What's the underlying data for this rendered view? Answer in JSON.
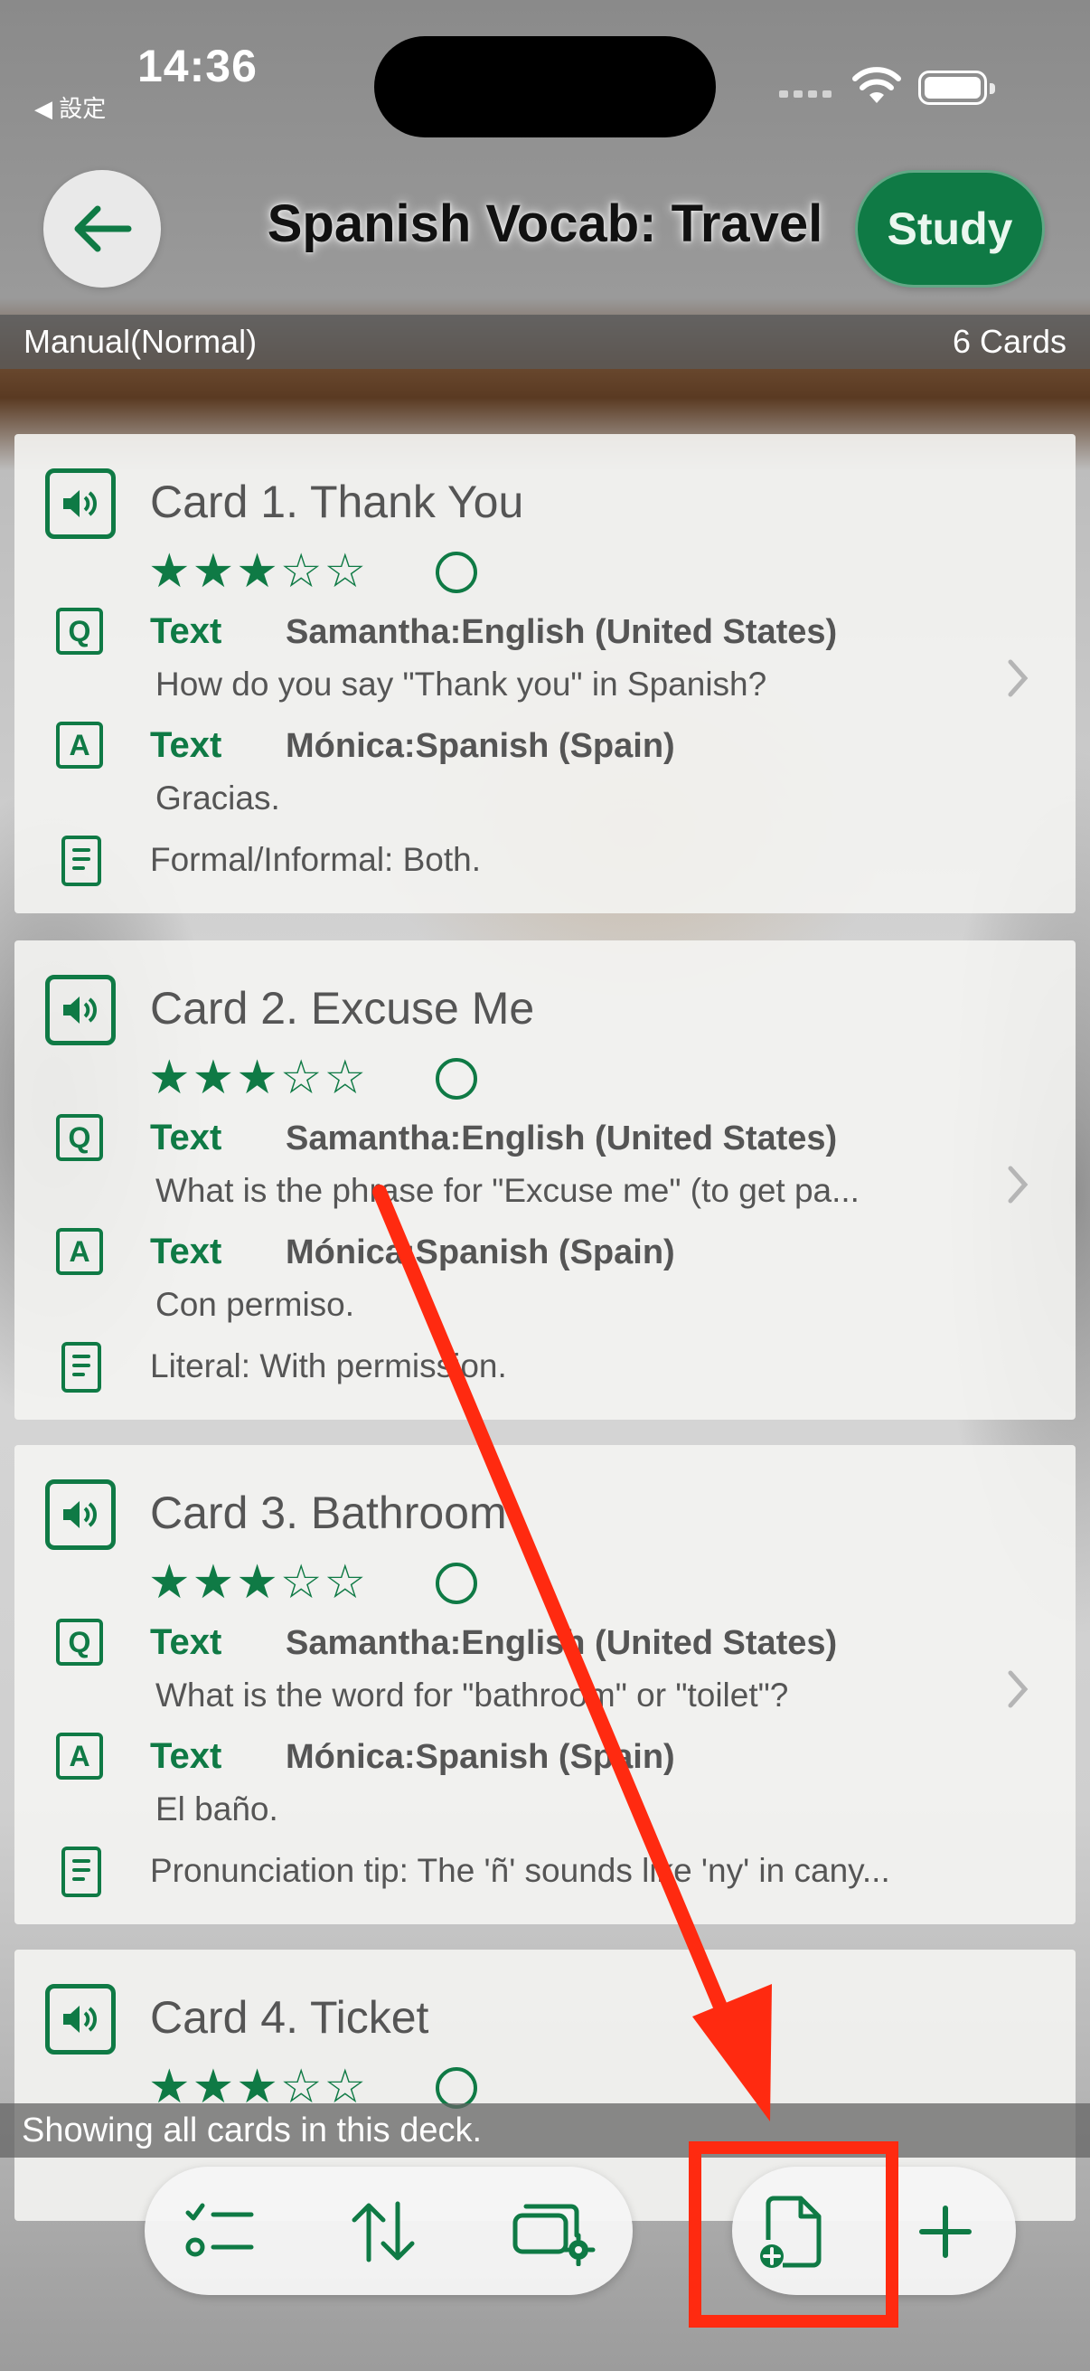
{
  "status": {
    "time": "14:36",
    "back_label": "◀ 設定"
  },
  "nav": {
    "title": "Spanish Vocab: Travel",
    "study_label": "Study",
    "back_icon": "arrow-left-icon"
  },
  "info": {
    "mode": "Manual(Normal)",
    "count": "6 Cards"
  },
  "cards": [
    {
      "title": "Card 1. Thank You",
      "stars": "★★★☆☆",
      "rating": 3,
      "q_icon": "Q",
      "q_kind": "Text",
      "q_voice": "Samantha:English (United States)",
      "q_text": "How do you say \"Thank you\" in Spanish?",
      "a_icon": "A",
      "a_kind": "Text",
      "a_voice": "Mónica:Spanish (Spain)",
      "a_text": "Gracias.",
      "note": "Formal/Informal: Both."
    },
    {
      "title": "Card 2. Excuse Me",
      "stars": "★★★☆☆",
      "rating": 3,
      "q_icon": "Q",
      "q_kind": "Text",
      "q_voice": "Samantha:English (United States)",
      "q_text": "What is the phrase for \"Excuse me\" (to get pa...",
      "a_icon": "A",
      "a_kind": "Text",
      "a_voice": "Mónica:Spanish (Spain)",
      "a_text": "Con permiso.",
      "note": "Literal: With permission."
    },
    {
      "title": "Card 3. Bathroom",
      "stars": "★★★☆☆",
      "rating": 3,
      "q_icon": "Q",
      "q_kind": "Text",
      "q_voice": "Samantha:English (United States)",
      "q_text": "What is the word for \"bathroom\" or \"toilet\"?",
      "a_icon": "A",
      "a_kind": "Text",
      "a_voice": "Mónica:Spanish (Spain)",
      "a_text": "El baño.",
      "note": "Pronunciation tip: The 'ñ' sounds like 'ny' in cany..."
    },
    {
      "title": "Card 4. Ticket",
      "stars": "★★★☆☆",
      "rating": 3
    }
  ],
  "footer": {
    "message": "Showing all cards in this deck."
  },
  "toolbar": {
    "items": [
      "checklist-icon",
      "sort-icon",
      "deck-settings-icon",
      "new-document-icon",
      "add-icon"
    ]
  },
  "colors": {
    "accent": "#0f7a45",
    "annotation": "#ff2a10"
  }
}
